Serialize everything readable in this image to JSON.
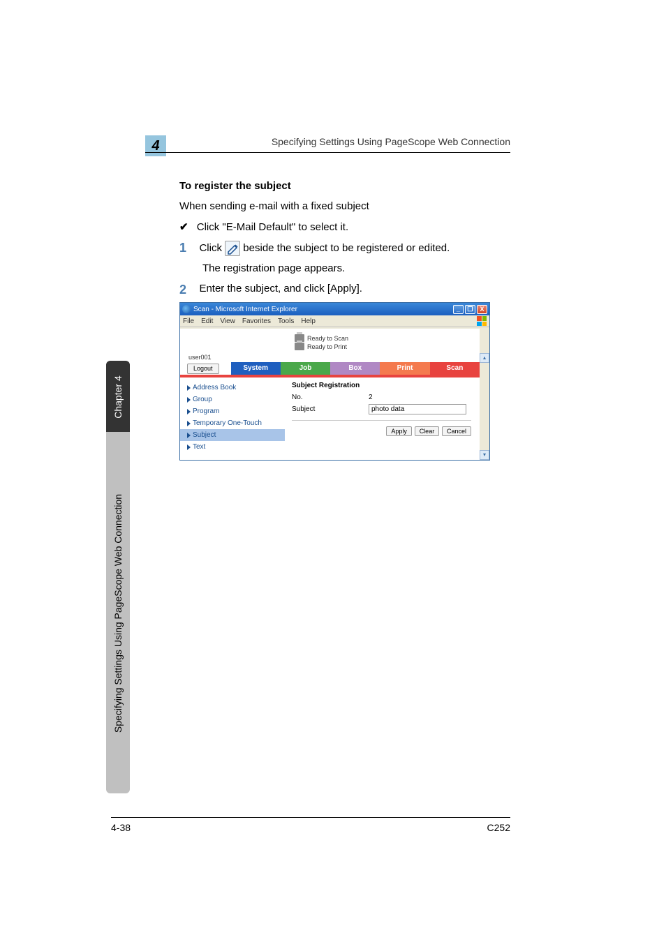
{
  "header": {
    "running_head": "Specifying Settings Using PageScope Web Connection",
    "chapter_num": "4"
  },
  "section": {
    "title": "To register the subject",
    "intro": "When sending e-mail with a fixed subject",
    "bullet_check": "✔",
    "bullet_text": "Click \"E-Mail Default\" to select it."
  },
  "steps": {
    "s1": {
      "num": "1",
      "pre": "Click ",
      "post": " beside the subject to be registered or edited.",
      "sub": "The registration page appears."
    },
    "s2": {
      "num": "2",
      "text": "Enter the subject, and click [Apply]."
    }
  },
  "side_tab": {
    "upper": "Chapter 4",
    "lower": "Specifying Settings Using PageScope Web Connection"
  },
  "browser": {
    "title": "Scan - Microsoft Internet Explorer",
    "min": "_",
    "max": "❐",
    "close": "X",
    "menu": [
      "File",
      "Edit",
      "View",
      "Favorites",
      "Tools",
      "Help"
    ],
    "status1": "Ready to Scan",
    "status2": "Ready to Print",
    "user": "user001",
    "logout": "Logout",
    "tabs": {
      "system": "System",
      "job": "Job",
      "box": "Box",
      "print": "Print",
      "scan": "Scan"
    },
    "nav": {
      "items": [
        {
          "label": "Address Book"
        },
        {
          "label": "Group"
        },
        {
          "label": "Program"
        },
        {
          "label": "Temporary One-Touch"
        },
        {
          "label": "Subject"
        },
        {
          "label": "Text"
        }
      ]
    },
    "panel": {
      "title": "Subject Registration",
      "no_label": "No.",
      "no_value": "2",
      "subject_label": "Subject",
      "subject_value": "photo data",
      "apply": "Apply",
      "clear": "Clear",
      "cancel": "Cancel"
    },
    "scroll_up": "▴",
    "scroll_down": "▾"
  },
  "footer": {
    "left": "4-38",
    "right": "C252"
  }
}
